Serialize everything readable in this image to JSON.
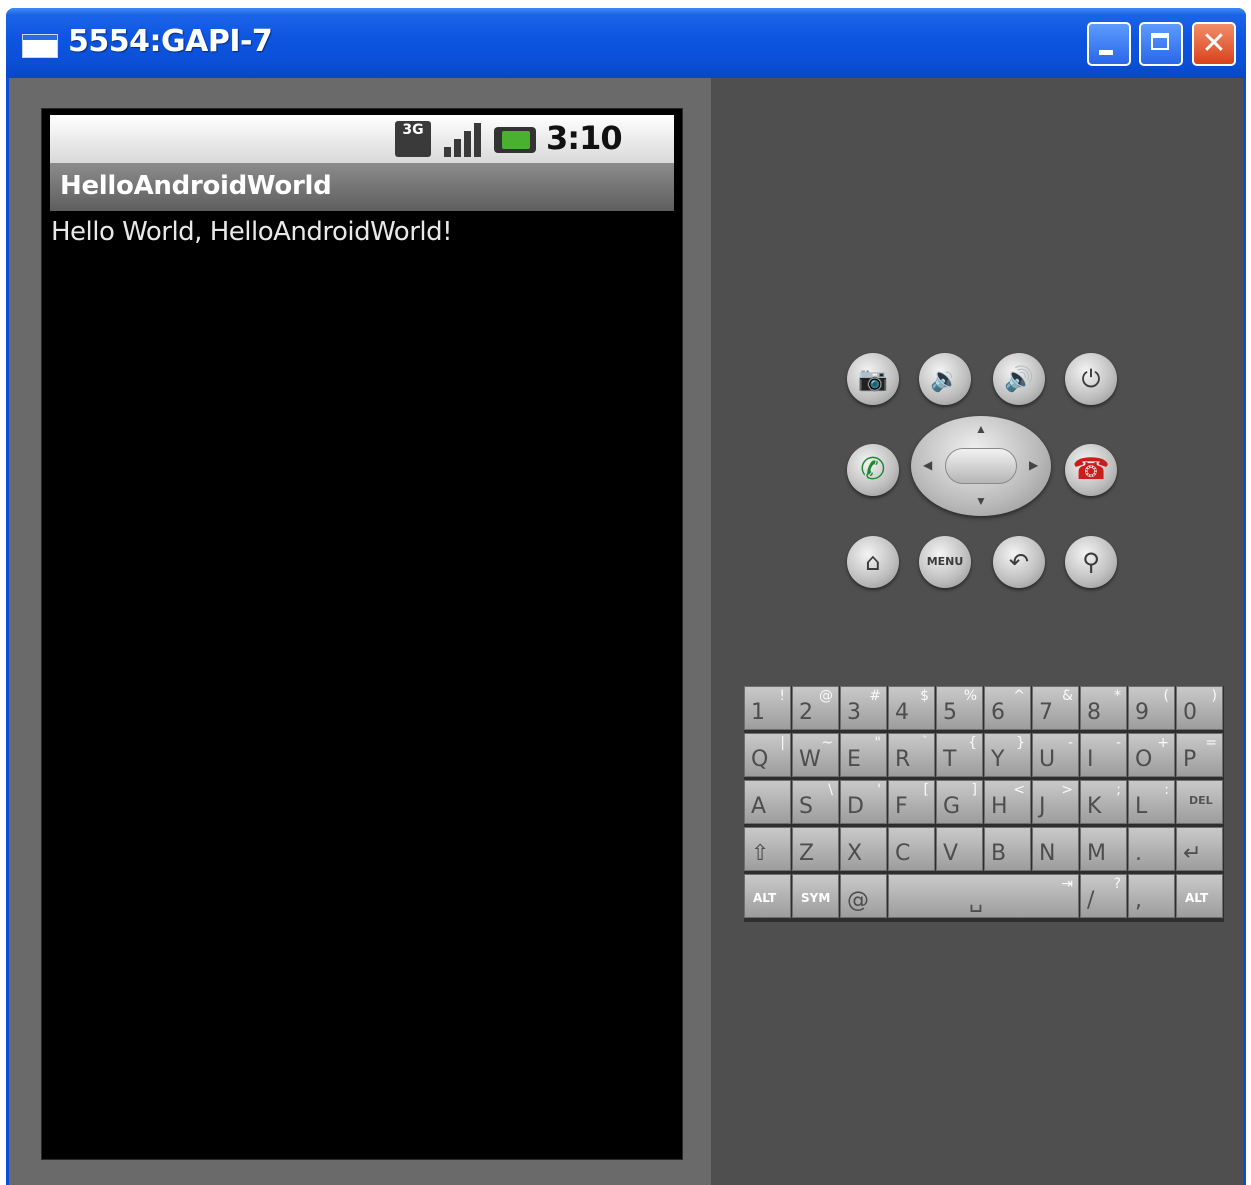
{
  "window": {
    "title": "5554:GAPI-7",
    "close_glyph": "✕"
  },
  "statusbar": {
    "network_label": "3G",
    "time": "3:10 PM"
  },
  "app": {
    "title": "HelloAndroidWorld",
    "content_text": "Hello World, HelloAndroidWorld!"
  },
  "hardware_buttons": {
    "row1": [
      "camera-icon",
      "volume-down-icon",
      "volume-up-icon",
      "power-icon"
    ],
    "row2": [
      "call-icon",
      "dpad",
      "end-call-icon"
    ],
    "row3": [
      "home-icon",
      "menu-button",
      "back-icon",
      "search-icon"
    ],
    "menu_label": "MENU"
  },
  "keyboard": {
    "row1": [
      {
        "main": "1",
        "alt": "!"
      },
      {
        "main": "2",
        "alt": "@"
      },
      {
        "main": "3",
        "alt": "#"
      },
      {
        "main": "4",
        "alt": "$"
      },
      {
        "main": "5",
        "alt": "%"
      },
      {
        "main": "6",
        "alt": "^"
      },
      {
        "main": "7",
        "alt": "&"
      },
      {
        "main": "8",
        "alt": "*"
      },
      {
        "main": "9",
        "alt": "("
      },
      {
        "main": "0",
        "alt": ")"
      }
    ],
    "row2": [
      {
        "main": "Q",
        "alt": "|"
      },
      {
        "main": "W",
        "alt": "~"
      },
      {
        "main": "E",
        "alt": "\""
      },
      {
        "main": "R",
        "alt": "`"
      },
      {
        "main": "T",
        "alt": "{"
      },
      {
        "main": "Y",
        "alt": "}"
      },
      {
        "main": "U",
        "alt": "-"
      },
      {
        "main": "I",
        "alt": "-"
      },
      {
        "main": "O",
        "alt": "+"
      },
      {
        "main": "P",
        "alt": "="
      }
    ],
    "row3": [
      {
        "main": "A",
        "alt": ""
      },
      {
        "main": "S",
        "alt": "\\"
      },
      {
        "main": "D",
        "alt": "'"
      },
      {
        "main": "F",
        "alt": "["
      },
      {
        "main": "G",
        "alt": "]"
      },
      {
        "main": "H",
        "alt": "<"
      },
      {
        "main": "J",
        "alt": ">"
      },
      {
        "main": "K",
        "alt": ";"
      },
      {
        "main": "L",
        "alt": ":"
      },
      {
        "main": "DEL",
        "alt": ""
      }
    ],
    "row4": [
      {
        "main": "⇧",
        "alt": ""
      },
      {
        "main": "Z",
        "alt": ""
      },
      {
        "main": "X",
        "alt": ""
      },
      {
        "main": "C",
        "alt": ""
      },
      {
        "main": "V",
        "alt": ""
      },
      {
        "main": "B",
        "alt": ""
      },
      {
        "main": "N",
        "alt": ""
      },
      {
        "main": "M",
        "alt": ""
      },
      {
        "main": ".",
        "alt": ""
      },
      {
        "main": "↵",
        "alt": ""
      }
    ],
    "row5": {
      "alt_left": "ALT",
      "sym": "SYM",
      "at": "@",
      "space": "␣",
      "tab": "⇥",
      "slash": "/",
      "slash_alt": "?",
      "comma": ",",
      "alt_right": "ALT"
    }
  }
}
